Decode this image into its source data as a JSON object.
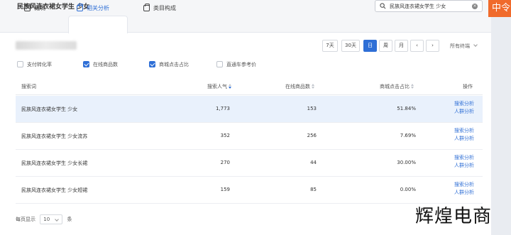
{
  "header": {
    "title": "民族风连衣裙女学生 少女"
  },
  "search": {
    "value": "民族风连衣裙女学生 少女"
  },
  "brand_tab": {
    "label": "中令"
  },
  "tabs": [
    {
      "label": "概况"
    },
    {
      "label": "相关分析"
    },
    {
      "label": "类目构成"
    }
  ],
  "date_buttons": [
    "7天",
    "30天",
    "日",
    "周",
    "月",
    "‹",
    "›"
  ],
  "filter": {
    "label": "所有终端"
  },
  "checkboxes": [
    {
      "label": "支付转化率",
      "checked": false
    },
    {
      "label": "在线商品数",
      "checked": true
    },
    {
      "label": "商城点击占比",
      "checked": true
    },
    {
      "label": "直通车参考价",
      "checked": false
    }
  ],
  "table": {
    "headers": [
      "搜索词",
      "搜索人气",
      "在线商品数",
      "商城点击占比",
      "操作"
    ],
    "rows": [
      {
        "term": "民族风连衣裙女学生 少女",
        "popularity": "1,773",
        "goods": "153",
        "ratio": "51.84%",
        "action1": "搜索分析",
        "action2": "人群分析"
      },
      {
        "term": "民族风连衣裙女学生 少女流苏",
        "popularity": "352",
        "goods": "256",
        "ratio": "7.69%",
        "action1": "搜索分析",
        "action2": "人群分析"
      },
      {
        "term": "民族风连衣裙女学生 少女长裙",
        "popularity": "270",
        "goods": "44",
        "ratio": "30.00%",
        "action1": "搜索分析",
        "action2": "人群分析"
      },
      {
        "term": "民族风连衣裙女学生 少女短裙",
        "popularity": "159",
        "goods": "85",
        "ratio": "0.00%",
        "action1": "搜索分析",
        "action2": "人群分析"
      }
    ]
  },
  "pager": {
    "prefix": "每页显示",
    "value": "10",
    "suffix": "条"
  },
  "watermark": {
    "text": "辉煌电商"
  },
  "colors": {
    "accent": "#2f6fd6",
    "brand": "#f06a2b",
    "row_highlight": "#e9f1fc"
  }
}
